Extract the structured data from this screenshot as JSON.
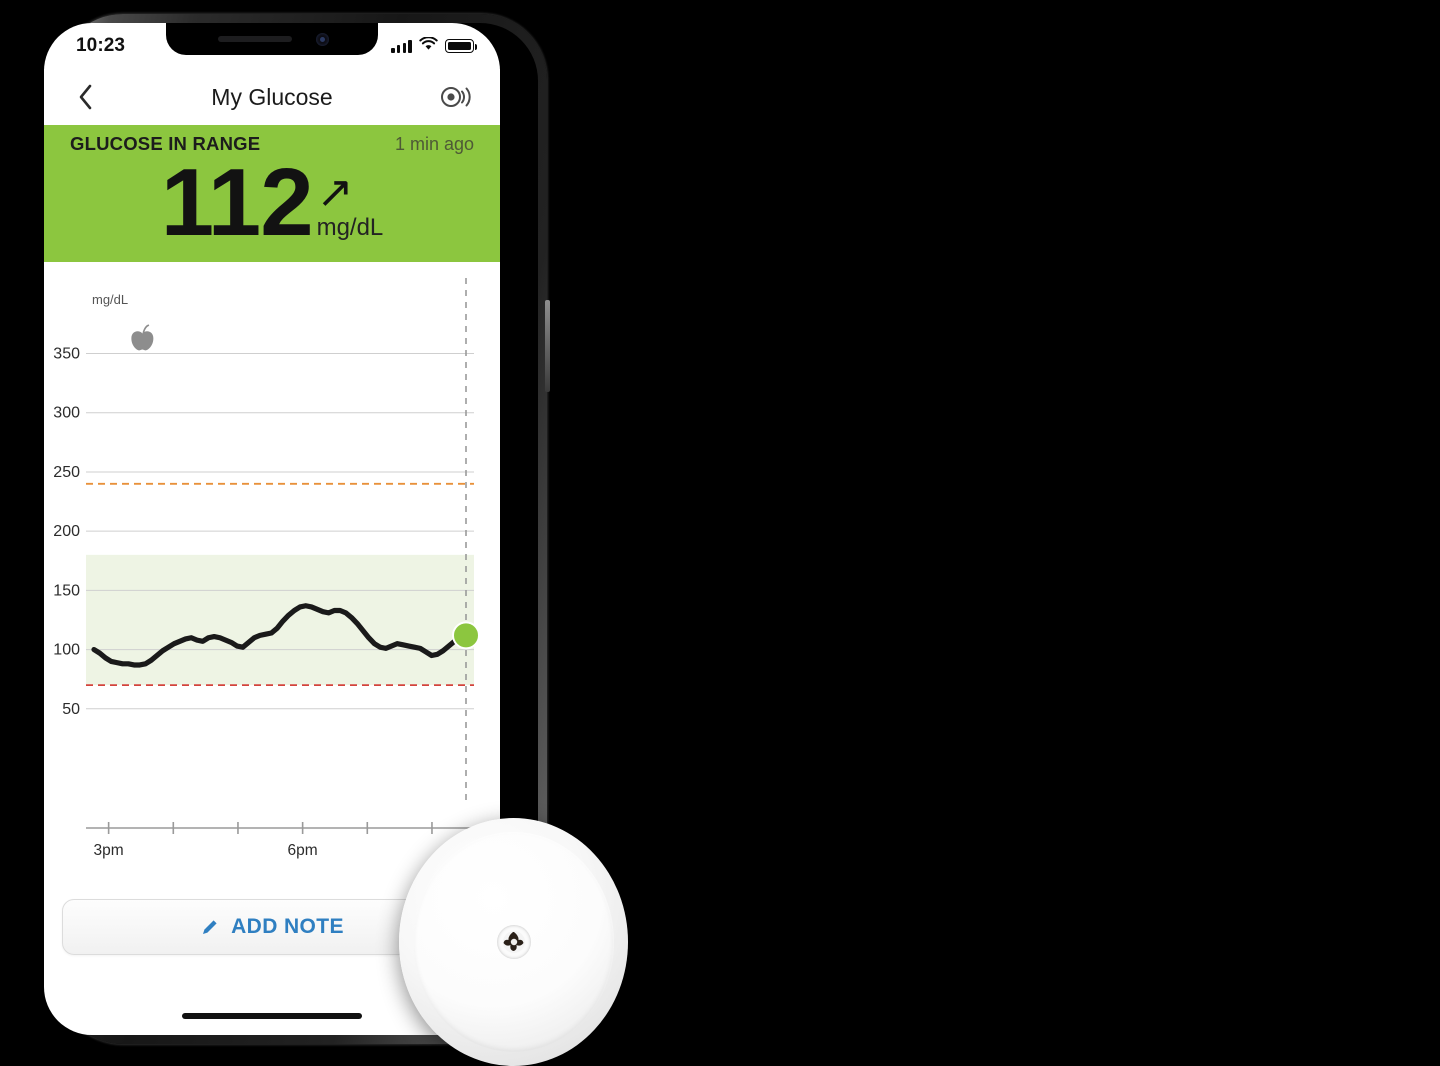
{
  "status_bar": {
    "time": "10:23",
    "signal_icon": "cellular-signal-icon",
    "wifi_icon": "wifi-icon",
    "battery_icon": "battery-full-icon"
  },
  "nav": {
    "back_icon": "chevron-left-icon",
    "title": "My Glucose",
    "scan_icon": "nfc-scan-icon"
  },
  "banner": {
    "status_label": "GLUCOSE IN RANGE",
    "updated_label": "1 min ago",
    "value": "112",
    "trend_arrow": "↗",
    "trend_name": "rising-slowly-arrow",
    "units": "mg/dL",
    "background_color": "#8CC63F"
  },
  "chart_data": {
    "type": "line",
    "title": "",
    "ylabel": "mg/dL",
    "xlabel": "",
    "ylim": [
      0,
      380
    ],
    "xlim": [
      0,
      100
    ],
    "grid": true,
    "y_ticks": [
      50,
      100,
      150,
      200,
      250,
      300,
      350
    ],
    "x_ticks": [
      "3pm",
      "",
      "",
      "6pm",
      "",
      ""
    ],
    "x_tick_labels": [
      "3pm",
      "6pm"
    ],
    "target_range": {
      "low": 70,
      "high": 180,
      "fill_color": "#eef4e4"
    },
    "high_threshold": {
      "value": 240,
      "color": "#E8913A",
      "style": "dashed"
    },
    "low_threshold": {
      "value": 70,
      "color": "#D3433C",
      "style": "dashed"
    },
    "current_marker": {
      "value": 112,
      "color": "#8CC63F",
      "line_color": "#9a9a9a",
      "line_style": "dashed"
    },
    "line_color": "#1a1a1a",
    "annotations": [
      {
        "icon": "apple-icon",
        "label": "food note",
        "x": 13,
        "y": 362,
        "color": "#8d8d8d"
      }
    ],
    "series": [
      {
        "name": "Glucose",
        "values": [
          100,
          97,
          93,
          90,
          89,
          88,
          88,
          87,
          87,
          88,
          91,
          95,
          99,
          102,
          105,
          107,
          109,
          110,
          108,
          107,
          110,
          111,
          110,
          108,
          106,
          103,
          102,
          106,
          110,
          112,
          113,
          114,
          118,
          124,
          129,
          133,
          136,
          137,
          136,
          134,
          132,
          131,
          133,
          133,
          131,
          127,
          122,
          116,
          110,
          105,
          102,
          101,
          103,
          105,
          104,
          103,
          102,
          101,
          98,
          95,
          96,
          99,
          103,
          107,
          110,
          112
        ]
      }
    ]
  },
  "add_note": {
    "icon": "pencil-icon",
    "label": "ADD NOTE",
    "color": "#2f7fc1"
  },
  "home_indicator": "home-indicator",
  "sensor": {
    "name": "cgm-sensor-device"
  }
}
